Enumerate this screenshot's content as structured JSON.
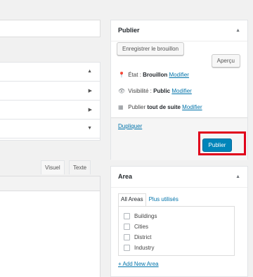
{
  "editor": {
    "tabs": {
      "visual": "Visuel",
      "text": "Texte"
    }
  },
  "publish_box": {
    "title": "Publier",
    "save_draft": "Enregistrer le brouillon",
    "preview": "Aperçu",
    "status_label": "État :",
    "status_value": "Brouillon",
    "status_edit": "Modifier",
    "visibility_label": "Visibilité :",
    "visibility_value": "Public",
    "visibility_edit": "Modifier",
    "schedule_label": "Publier",
    "schedule_value": "tout de suite",
    "schedule_edit": "Modifier",
    "duplicate": "Dupliquer",
    "publish": "Publier"
  },
  "area_box": {
    "title": "Area",
    "tab_all": "All Areas",
    "tab_popular": "Plus utilisés",
    "items": [
      "Buildings",
      "Cities",
      "District",
      "Industry"
    ],
    "add_new": "+ Add New Area"
  },
  "colors": {
    "accent": "#0085ba",
    "link": "#0073aa",
    "highlight": "#e0001b"
  }
}
